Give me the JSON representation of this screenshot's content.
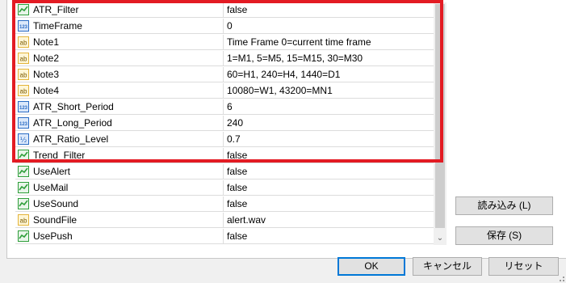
{
  "params": [
    {
      "icon": "bool-icon",
      "name": "ATR_Filter",
      "value": "false"
    },
    {
      "icon": "int-icon",
      "name": "TimeFrame",
      "value": "0"
    },
    {
      "icon": "string-icon",
      "name": "Note1",
      "value": "Time Frame 0=current time frame"
    },
    {
      "icon": "string-icon",
      "name": "Note2",
      "value": "1=M1, 5=M5, 15=M15, 30=M30"
    },
    {
      "icon": "string-icon",
      "name": "Note3",
      "value": "60=H1, 240=H4, 1440=D1"
    },
    {
      "icon": "string-icon",
      "name": "Note4",
      "value": "10080=W1, 43200=MN1"
    },
    {
      "icon": "int-icon",
      "name": "ATR_Short_Period",
      "value": "6"
    },
    {
      "icon": "int-icon",
      "name": "ATR_Long_Period",
      "value": "240"
    },
    {
      "icon": "double-icon",
      "name": "ATR_Ratio_Level",
      "value": "0.7"
    },
    {
      "icon": "bool-icon",
      "name": "Trend_Filter",
      "value": "false"
    },
    {
      "icon": "bool-icon",
      "name": "UseAlert",
      "value": "false"
    },
    {
      "icon": "bool-icon",
      "name": "UseMail",
      "value": "false"
    },
    {
      "icon": "bool-icon",
      "name": "UseSound",
      "value": "false"
    },
    {
      "icon": "string-icon",
      "name": "SoundFile",
      "value": "alert.wav"
    },
    {
      "icon": "bool-icon",
      "name": "UsePush",
      "value": "false"
    }
  ],
  "icon_labels": {
    "int": "123",
    "string": "ab",
    "double": "½"
  },
  "buttons": {
    "load": "読み込み (L)",
    "save": "保存 (S)",
    "ok": "OK",
    "cancel": "キャンセル",
    "reset": "リセット"
  },
  "colors": {
    "highlight_border": "#e31b23",
    "bool_icon_green": "#2e9e3a",
    "int_icon_blue": "#2b6cc4",
    "string_icon_yellow": "#e3b43a",
    "ok_button_border": "#0078d7"
  }
}
